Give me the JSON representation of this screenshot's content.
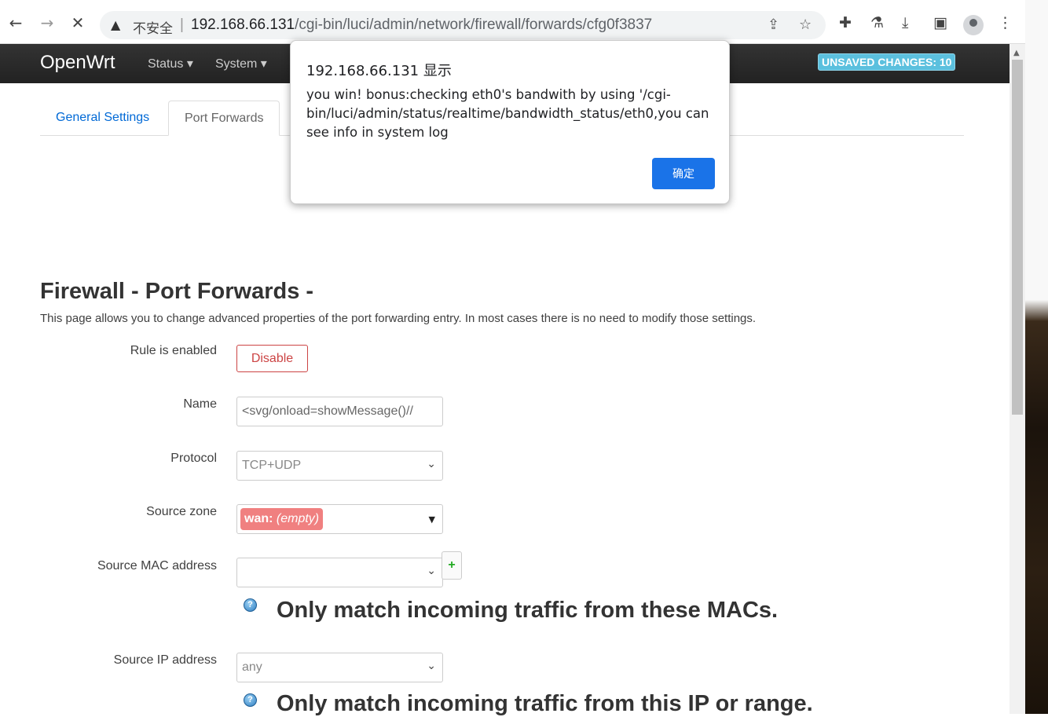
{
  "browser": {
    "insecure_label": "不安全",
    "url_host": "192.168.66.131",
    "url_path": "/cgi-bin/luci/admin/network/firewall/forwards/cfg0f3837"
  },
  "header": {
    "brand": "OpenWrt",
    "menu": [
      "Status",
      "System"
    ],
    "unsaved": "UNSAVED CHANGES: 10"
  },
  "tabs": [
    "General Settings",
    "Port Forwards"
  ],
  "page": {
    "title": "Firewall - Port Forwards -",
    "description": "This page allows you to change advanced properties of the port forwarding entry. In most cases there is no need to modify those settings."
  },
  "form": {
    "enabled_label": "Rule is enabled",
    "disable_btn": "Disable",
    "name_label": "Name",
    "name_value": "<svg/onload=showMessage()//",
    "protocol_label": "Protocol",
    "protocol_value": "TCP+UDP",
    "zone_label": "Source zone",
    "zone_name": "wan:",
    "zone_value": "(empty)",
    "mac_label": "Source MAC address",
    "mac_value": "",
    "mac_help": "Only match incoming traffic from these MACs.",
    "ip_label": "Source IP address",
    "ip_value": "any",
    "ip_help": "Only match incoming traffic from this IP or range."
  },
  "dialog": {
    "title": "192.168.66.131 显示",
    "message": "you win! bonus:checking eth0's bandwith by using '/cgi-bin/luci/admin/status/realtime/bandwidth_status/eth0,you can see info in system log",
    "ok": "确定"
  },
  "colors": {
    "header_bg": "#222222",
    "badge": "#5bc0de",
    "disable": "#cc4444",
    "zone_chip": "#f08080",
    "dialog_button": "#1a73e8",
    "tab_link": "#0069d6"
  }
}
